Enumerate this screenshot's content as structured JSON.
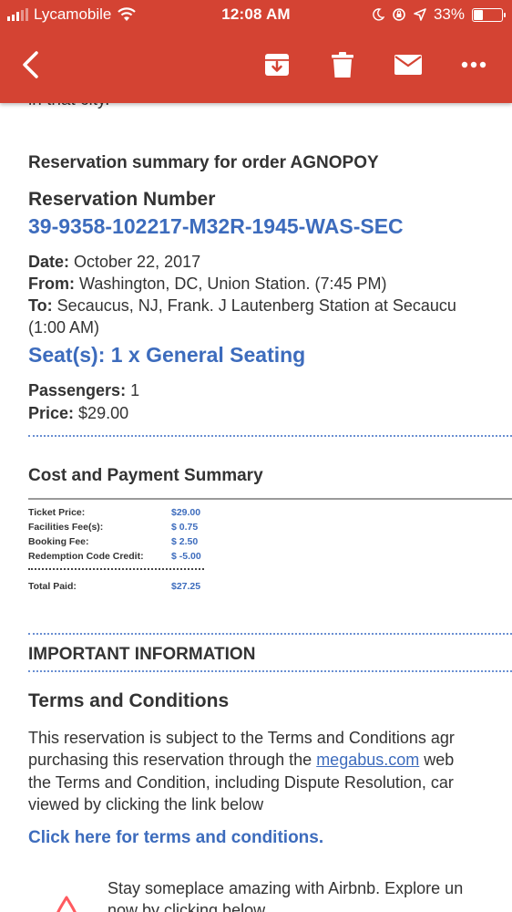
{
  "status_bar": {
    "carrier": "Lycamobile",
    "time": "12:08 AM",
    "battery": "33%",
    "battery_level": 0.33
  },
  "toolbar": {
    "back_icon": "chevron-left-icon",
    "archive_icon": "archive-icon",
    "delete_icon": "trash-icon",
    "mail_icon": "mail-icon",
    "more_icon": "more-horizontal-icon"
  },
  "email": {
    "clipped_text": "in that city.",
    "order_heading": "Reservation summary for order AGNOPOY",
    "reservation_label": "Reservation Number",
    "reservation_number": "39-9358-102217-M32R-1945-WAS-SEC",
    "date_label": "Date:",
    "date_value": "October 22, 2017",
    "from_label": "From:",
    "from_value": "Washington, DC, Union Station. (7:45 PM)",
    "to_label": "To:",
    "to_value": "Secaucus, NJ, Frank. J Lautenberg Station at Secaucu",
    "to_time": "(1:00 AM)",
    "seats": "Seat(s): 1 x General Seating",
    "passengers_label": "Passengers:",
    "passengers_value": "1",
    "price_label": "Price:",
    "price_value": "$29.00",
    "cost_title": "Cost and Payment Summary",
    "cost_rows": [
      {
        "label": "Ticket Price:",
        "value": "$29.00"
      },
      {
        "label": "Facilities Fee(s):",
        "value": "$  0.75"
      },
      {
        "label": "Booking Fee:",
        "value": "$  2.50"
      },
      {
        "label": "Redemption Code Credit:",
        "value": "$ -5.00"
      }
    ],
    "total_label": "Total Paid:",
    "total_value": "$27.25",
    "important_heading": "IMPORTANT INFORMATION",
    "terms_heading": "Terms and Conditions",
    "terms_line1": "This reservation is subject to the Terms and Conditions agr",
    "terms_line2_pre": "purchasing this reservation through the ",
    "terms_line2_link": "megabus.com",
    "terms_line2_post": " web",
    "terms_line3": "the Terms and Condition, including Dispute Resolution, car",
    "terms_line4": "viewed by clicking the link below",
    "terms_link": "Click here for terms and conditions.",
    "airbnb_line1": "Stay someplace amazing with Airbnb. Explore un",
    "airbnb_line2": "now by clicking below"
  },
  "colors": {
    "header_red": "#d44333",
    "link_blue": "#3d6cbd",
    "airbnb_red": "#ff5a5f"
  }
}
